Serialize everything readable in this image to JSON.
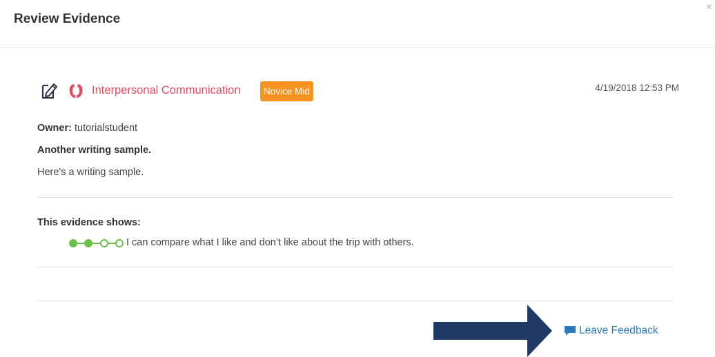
{
  "dialog": {
    "title": "Review Evidence",
    "close_symbol": "×"
  },
  "evidence": {
    "type_icon": "document-edit-icon",
    "mode_icon": "interpersonal-communication-icon",
    "mode_label": "Interpersonal  Communication",
    "level_badge": "Novice Mid",
    "timestamp": "4/19/2018 12:53 PM",
    "owner_label": "Owner:",
    "owner_value": " tutorialstudent",
    "title": "Another writing sample.",
    "description": "Here's a writing sample."
  },
  "shows": {
    "label": "This evidence shows:",
    "can_do": {
      "progress_filled": 2,
      "progress_total": 4,
      "statement": "I can compare what I like and don’t like about the trip with others."
    }
  },
  "footer": {
    "feedback_icon": "comment-icon",
    "feedback_label": "Leave Feedback"
  },
  "colors": {
    "mode_red": "#e84a5f",
    "badge_orange": "#f7931e",
    "progress_green": "#6cc04a",
    "link_blue": "#2a7ab8",
    "arrow_navy": "#1f3864"
  }
}
